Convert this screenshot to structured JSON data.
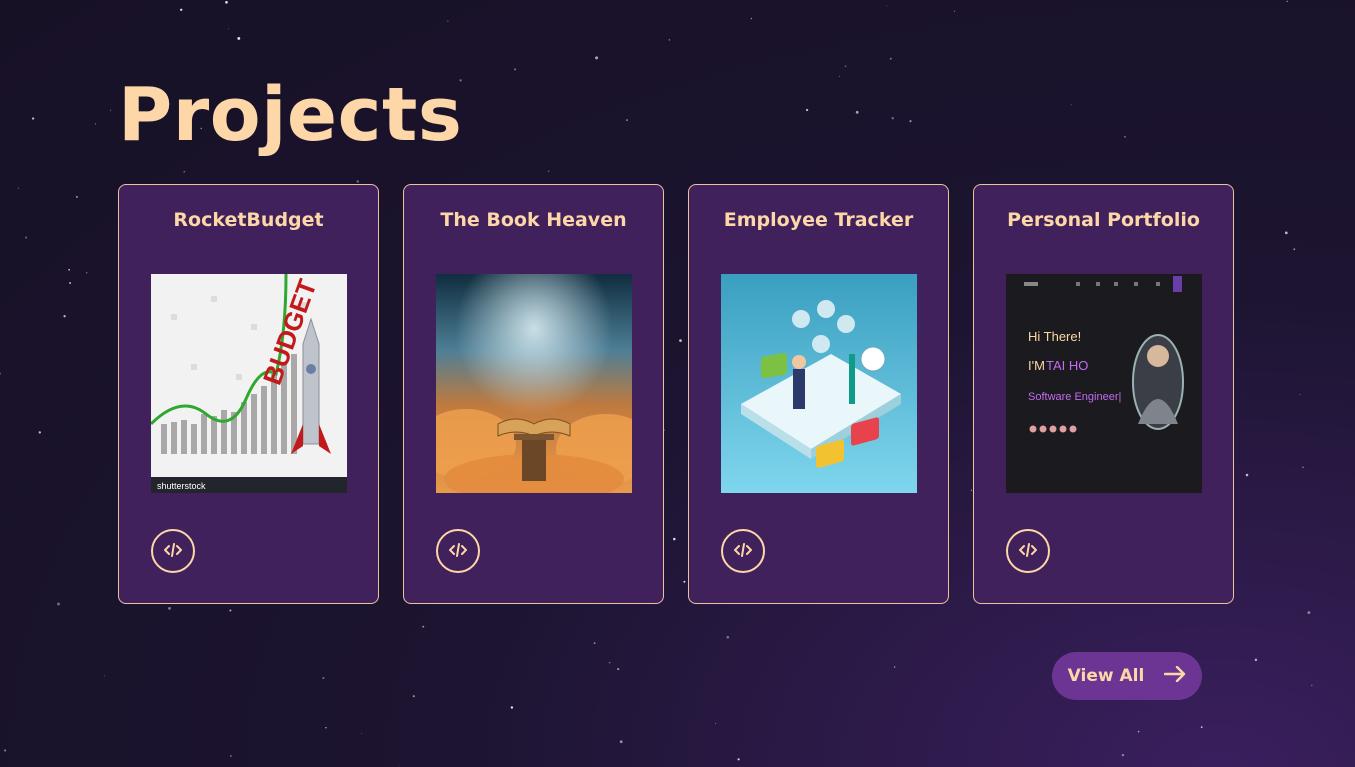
{
  "section": {
    "title": "Projects"
  },
  "projects": [
    {
      "title": "RocketBudget",
      "image": "rocket-budget-chart-image",
      "image_text": [
        "BUDGET",
        "shutterstock"
      ]
    },
    {
      "title": "The Book Heaven",
      "image": "open-book-in-clouds-image"
    },
    {
      "title": "Employee Tracker",
      "image": "isometric-office-team-image"
    },
    {
      "title": "Personal Portfolio",
      "image": "portfolio-site-screenshot-image",
      "image_text": [
        "Hi There!",
        "I'M",
        "TAI HO",
        "Software Engineer|"
      ]
    }
  ],
  "code_icon": "code-icon",
  "view_all": {
    "label": "View All",
    "icon": "arrow-right-icon"
  },
  "colors": {
    "accent": "#fdd7a7",
    "card_bg": "#40215b",
    "button_bg": "#6c3593",
    "page_bg": "#1c1430"
  }
}
